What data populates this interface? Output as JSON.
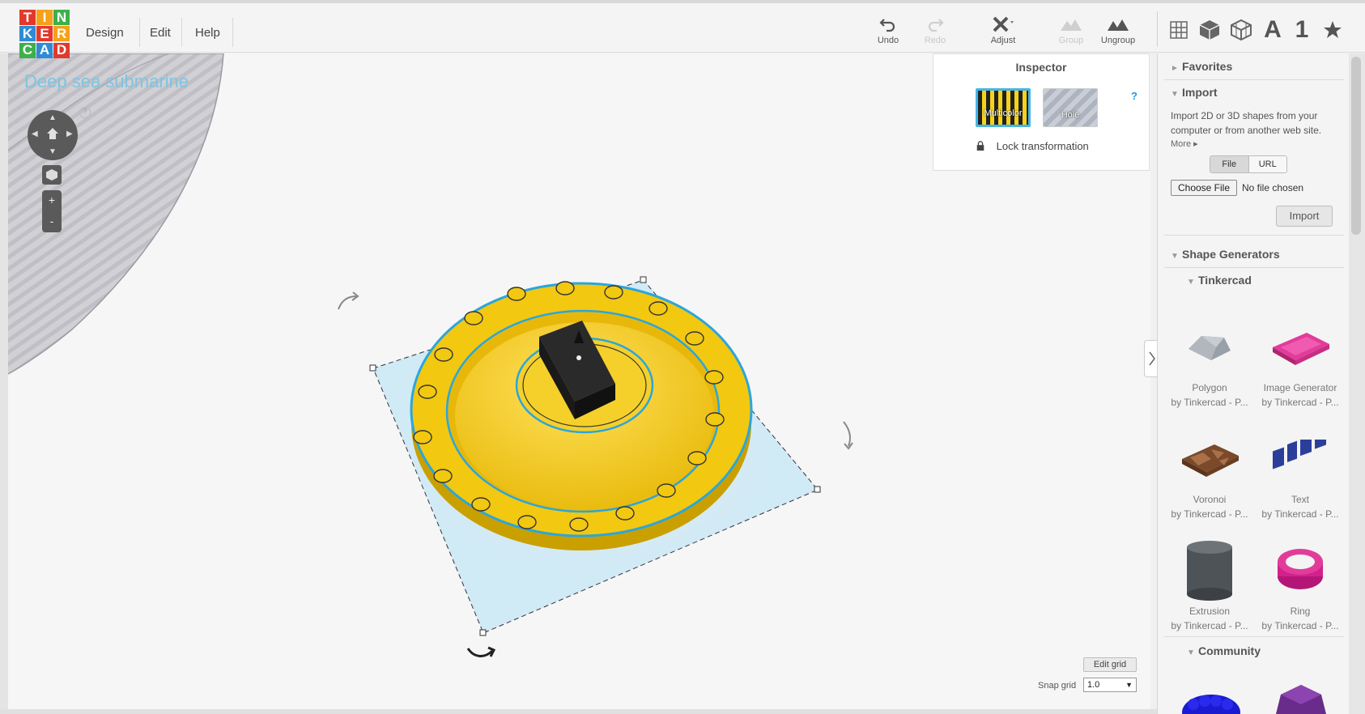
{
  "app": {
    "logo_letters": [
      "T",
      "I",
      "N",
      "K",
      "E",
      "R",
      "C",
      "A",
      "D"
    ],
    "logo_colors": [
      "#e2392d",
      "#f7a01a",
      "#3cb04a",
      "#2f8bd3",
      "#e2392d",
      "#f7a01a",
      "#3cb04a",
      "#2f8bd3",
      "#e2392d"
    ]
  },
  "menu": {
    "design": "Design",
    "edit": "Edit",
    "help": "Help"
  },
  "toolbar": {
    "undo": "Undo",
    "redo": "Redo",
    "adjust": "Adjust",
    "group": "Group",
    "ungroup": "Ungroup",
    "text_icon": "A",
    "number_icon": "1"
  },
  "project": {
    "title": "Deep sea submarine"
  },
  "nav": {
    "help": "?",
    "zoom_in": "+",
    "zoom_out": "-"
  },
  "inspector": {
    "title": "Inspector",
    "help": "?",
    "multicolor_label": "Multicolor",
    "hole_label": "Hole",
    "lock_label": "Lock transformation"
  },
  "panel": {
    "favorites": "Favorites",
    "import": {
      "title": "Import",
      "description": "Import 2D or 3D shapes from your computer or from another web site.",
      "more": "More",
      "tab_file": "File",
      "tab_url": "URL",
      "choose_file": "Choose File",
      "no_file": "No file chosen",
      "import_button": "Import"
    },
    "shape_generators": "Shape Generators",
    "tinkercad": "Tinkercad",
    "community": "Community",
    "shapes": [
      {
        "name": "Polygon",
        "by": "by Tinkercad - P..."
      },
      {
        "name": "Image Generator",
        "by": "by Tinkercad - P..."
      },
      {
        "name": "Voronoi",
        "by": "by Tinkercad - P..."
      },
      {
        "name": "Text",
        "by": "by Tinkercad - P..."
      },
      {
        "name": "Extrusion",
        "by": "by Tinkercad - P..."
      },
      {
        "name": "Ring",
        "by": "by Tinkercad - P..."
      }
    ]
  },
  "grid": {
    "edit_grid": "Edit grid",
    "snap_label": "Snap grid",
    "snap_value": "1.0"
  },
  "colors": {
    "accent": "#1b9ad6",
    "shape_yellow": "#f4cc14",
    "selection_blue": "#cde9f6"
  }
}
